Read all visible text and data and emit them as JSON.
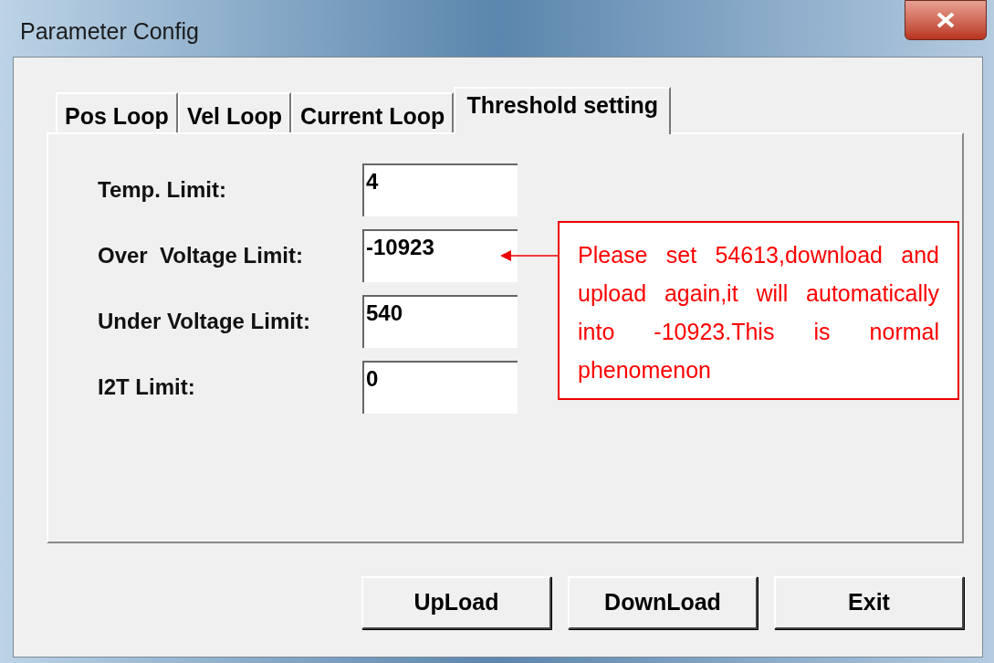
{
  "window": {
    "title": "Parameter Config"
  },
  "tabs": [
    {
      "label": "Pos Loop",
      "selected": false
    },
    {
      "label": "Vel Loop",
      "selected": false
    },
    {
      "label": "Current Loop",
      "selected": false
    },
    {
      "label": "Threshold setting",
      "selected": true
    }
  ],
  "fields": [
    {
      "label": "Temp. Limit:",
      "value": "4"
    },
    {
      "label": "Over  Voltage Limit:",
      "value": "-10923"
    },
    {
      "label": "Under Voltage Limit:",
      "value": "540"
    },
    {
      "label": "I2T Limit:",
      "value": "0"
    }
  ],
  "annotation": {
    "text": "Please set 54613,download and upload again,it will automatically into -10923.This is normal phenomenon"
  },
  "buttons": [
    "UpLoad",
    "DownLoad",
    "Exit"
  ]
}
